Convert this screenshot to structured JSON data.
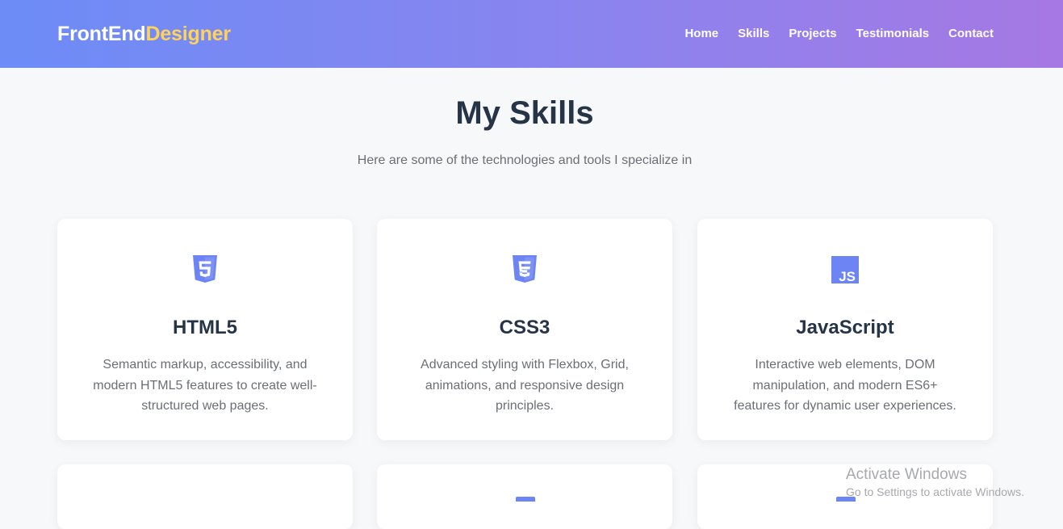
{
  "navbar": {
    "logo_main": "FrontEnd",
    "logo_accent": "Designer",
    "links": [
      "Home",
      "Skills",
      "Projects",
      "Testimonials",
      "Contact"
    ]
  },
  "skills": {
    "title": "My Skills",
    "subtitle": "Here are some of the technologies and tools I specialize in",
    "cards": [
      {
        "icon": "html5-icon",
        "title": "HTML5",
        "description": "Semantic markup, accessibility, and modern HTML5 features to create well-structured web pages."
      },
      {
        "icon": "css3-icon",
        "title": "CSS3",
        "description": "Advanced styling with Flexbox, Grid, animations, and responsive design principles."
      },
      {
        "icon": "javascript-icon",
        "title": "JavaScript",
        "description": "Interactive web elements, DOM manipulation, and modern ES6+ features for dynamic user experiences."
      }
    ]
  },
  "watermark": {
    "title": "Activate Windows",
    "subtitle": "Go to Settings to activate Windows."
  },
  "colors": {
    "nav_gradient_start": "#6d8cf6",
    "nav_gradient_end": "#a678e3",
    "logo_accent": "#ffd35a",
    "icon": "#6d84f4",
    "heading": "#263447",
    "body_text": "#6b6f75",
    "page_background": "#f7f8fa"
  }
}
